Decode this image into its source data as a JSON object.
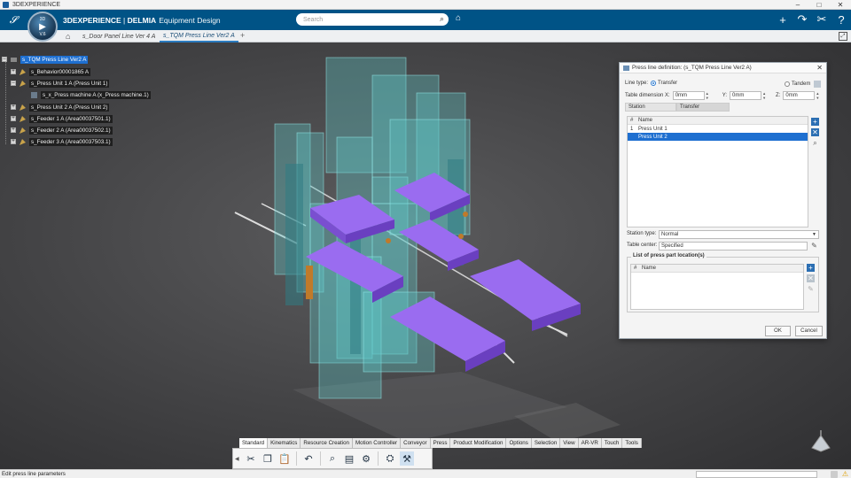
{
  "os": {
    "title": "3DEXPERIENCE",
    "minimize": "–",
    "maximize": "□",
    "close": "✕"
  },
  "header": {
    "brand_bold": "3DEXPERIENCE",
    "brand_sep": " | ",
    "brand_product": "DELMIA",
    "app_name": "Equipment Design",
    "compass_version": "V.6",
    "compass_n": "3D",
    "search_placeholder": "Search",
    "accent": "#005386"
  },
  "tabs": [
    {
      "label": "s_Door Panel Line Ver 4 A",
      "active": false
    },
    {
      "label": "s_TQM Press Line Ver2 A",
      "active": true
    }
  ],
  "tree": {
    "root": "s_TQM Press Line Ver2 A",
    "nodes": [
      {
        "label": "s_Behavior00001865 A",
        "level": 1,
        "exp": "+"
      },
      {
        "label": "s_Press Unit 1 A (Press Unit 1)",
        "level": 1,
        "exp": "–"
      },
      {
        "label": "s_x_Press machine A (x_Press machine.1)",
        "level": 2,
        "exp": ""
      },
      {
        "label": "s_Press Unit 2 A (Press Unit 2)",
        "level": 1,
        "exp": "+"
      },
      {
        "label": "s_Feeder 1 A (Area00037501.1)",
        "level": 1,
        "exp": "+"
      },
      {
        "label": "s_Feeder 2 A (Area00037502.1)",
        "level": 1,
        "exp": "+"
      },
      {
        "label": "s_Feeder 3 A (Area00037503.1)",
        "level": 1,
        "exp": "+"
      }
    ]
  },
  "dialog": {
    "title": "Press line definition: (s_TQM Press Line Ver2 A)",
    "line_type_label": "Line type:",
    "line_type_options": [
      "Transfer",
      "Tandem"
    ],
    "line_type_selected": "Transfer",
    "table_dimension_label": "Table dimension X:",
    "dim_x": "0mm",
    "dim_y_label": "Y:",
    "dim_y": "0mm",
    "dim_z_label": "Z:",
    "dim_z": "0mm",
    "subtabs": [
      "Station",
      "Transfer"
    ],
    "station_table": {
      "headers": [
        "#",
        "Name"
      ],
      "rows": [
        {
          "num": "1",
          "name": "Press Unit 1",
          "selected": false
        },
        {
          "num": "",
          "name": "Press Unit 2",
          "selected": true
        }
      ]
    },
    "station_type_label": "Station type:",
    "station_type": "Normal",
    "table_center_label": "Table center:",
    "table_center": "Specified",
    "press_part_group": "List of press part location(s)",
    "press_part_headers": [
      "#",
      "Name"
    ],
    "ok": "OK",
    "cancel": "Cancel"
  },
  "action_tabs": [
    "Standard",
    "Kinematics",
    "Resource Creation",
    "Motion Controller",
    "Conveyor",
    "Press",
    "Product Modification",
    "Options",
    "Selection",
    "View",
    "AR-VR",
    "Touch",
    "Tools"
  ],
  "action_tab_active": "Standard",
  "status": {
    "message": "Edit press line parameters"
  },
  "colors": {
    "selection": "#1e6fd0",
    "press_plate": "#8a5fe0",
    "glass": "#5fc8c8"
  }
}
